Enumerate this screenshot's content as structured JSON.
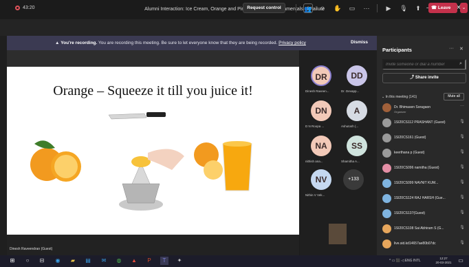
{
  "window": {
    "title": "Alumni Interaction: Ice Cream, Orange and Pineapple - The Fundamentals of Failure",
    "minimize": "–",
    "maximize": "❐",
    "close": "✕"
  },
  "toolbar": {
    "timer": "43:20",
    "request_control": "Request control",
    "leave": "Leave",
    "leave_chevron": "⌄",
    "icons": [
      "people-icon",
      "chat-icon",
      "reactions-icon",
      "view-icon",
      "more-icon",
      "camera-off-icon",
      "mic-off-icon",
      "share-icon"
    ]
  },
  "banner": {
    "bold": "You're recording.",
    "text": " You are recording this meeting. Be sure to let everyone know that they are being recorded.",
    "link": "Privacy policy",
    "dismiss": "Dismiss"
  },
  "slide": {
    "title": "Orange – Squeeze it till you juice it!",
    "presenter": "Dinesh Raveendran (Guest)"
  },
  "tiles": [
    {
      "initials": "DR",
      "name": "Dinesh Raveen...",
      "color": "#f2c9b8"
    },
    {
      "initials": "DD",
      "name": "Dr. Devapp...",
      "color": "#c9c5e8"
    },
    {
      "initials": "DN",
      "name": "D N Roopa ...",
      "color": "#f2c9b8"
    },
    {
      "initials": "A",
      "name": "Ashutosh (...",
      "color": "#d6dbe3"
    },
    {
      "initials": "NA",
      "name": "nithish ana...",
      "color": "#f2c9b8"
    },
    {
      "initials": "SS",
      "name": "Shamitha A...",
      "color": "#cfe3dd"
    },
    {
      "initials": "NV",
      "name": "Nithin V Vek...",
      "color": "#c5d8f0"
    }
  ],
  "more_count": "+133",
  "panel": {
    "title": "Participants",
    "invite_placeholder": "Invite someone or dial a number",
    "share_invite": "Share invite",
    "in_meeting": "In this meeting (141)",
    "mute_all": "Mute all",
    "participants": [
      {
        "name": "Dr. Bhimasen Soragaon",
        "role": "Organizer",
        "avatar": "photo",
        "mic": "···"
      },
      {
        "name": "1SI20CS112 PRASHANT (Guest)",
        "avatar": "gray",
        "mic": "🎙"
      },
      {
        "name": "1SI20CS161 (Guest)",
        "avatar": "gray",
        "mic": "🎙"
      },
      {
        "name": "keerthana p (Guest)",
        "avatar": "gray",
        "mic": "🎙"
      },
      {
        "name": "1SI20CS096 namitha (Guest)",
        "avatar": "pink",
        "mic": "🎙"
      },
      {
        "name": "1SI20CS099 NAVNIT KUM...",
        "avatar": "blue",
        "mic": "🎙"
      },
      {
        "name": "1SI20CS124 RAJ HARSH (Gue...",
        "avatar": "blue",
        "mic": "🎙"
      },
      {
        "name": "1SI20CS137(Guest)",
        "avatar": "blue",
        "mic": "🎙"
      },
      {
        "name": "1SI20CS108 Sai Abhiram S (G...",
        "avatar": "orange",
        "mic": "🎙"
      },
      {
        "name": "live.sid.kd14657ae80b07dc",
        "avatar": "orange",
        "mic": "🎙"
      }
    ]
  },
  "taskbar": {
    "tray": "^ ▭ ⬛ ◁ ENG INTL",
    "time": "12:27",
    "date": "20-03-2021"
  }
}
